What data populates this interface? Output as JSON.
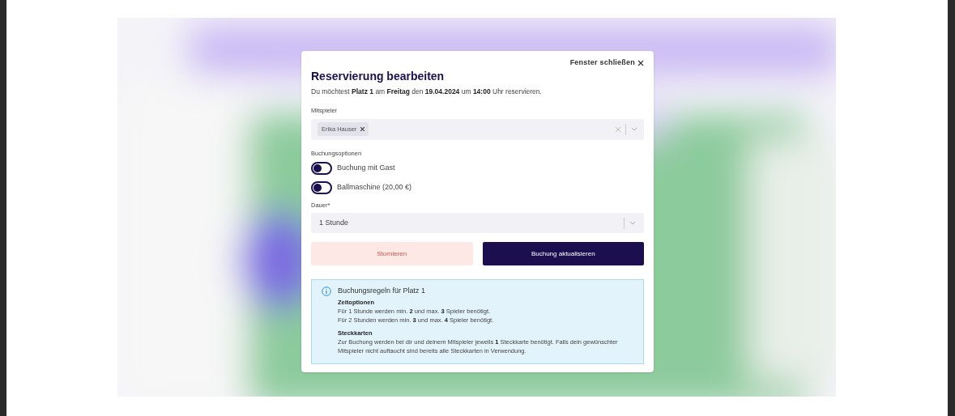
{
  "dialog": {
    "close_label": "Fenster schließen",
    "title": "Reservierung bearbeiten",
    "intro": "Du möchtest **Platz 1** am **Freitag** den **19.04.2024** um **14:00** Uhr reservieren.",
    "players": {
      "label": "Mitspieler",
      "tags": [
        "Erika Hauser"
      ]
    },
    "options": {
      "label": "Buchungsoptionen",
      "toggles": [
        {
          "label": "Buchung mit Gast",
          "on": false
        },
        {
          "label": "Ballmaschine (20,00 €)",
          "on": false
        }
      ]
    },
    "duration": {
      "label": "Dauer*",
      "value": "1 Stunde"
    },
    "buttons": [
      {
        "kind": "danger",
        "label": "Stornieren"
      },
      {
        "kind": "primary",
        "label": "Buchung aktualisieren"
      }
    ],
    "rules": {
      "title": "Buchungsregeln für Platz 1",
      "sections": [
        {
          "heading": "Zeitoptionen",
          "lines": [
            "Für 1 Stunde werden min. **2** und max. **3** Spieler benötigt.",
            "Für 2 Stunden werden min. **3** und max. **4** Spieler benötigt."
          ]
        },
        {
          "heading": "Steckkarten",
          "lines": [
            "Zur Buchung werden bei dir und deinem Mitspieler jeweils **1** Steckkarte benötigt. Falls dein gewünschter Mitspieler nicht auftaucht sind bereits alle Steckkarten in Verwendung."
          ]
        }
      ]
    }
  }
}
